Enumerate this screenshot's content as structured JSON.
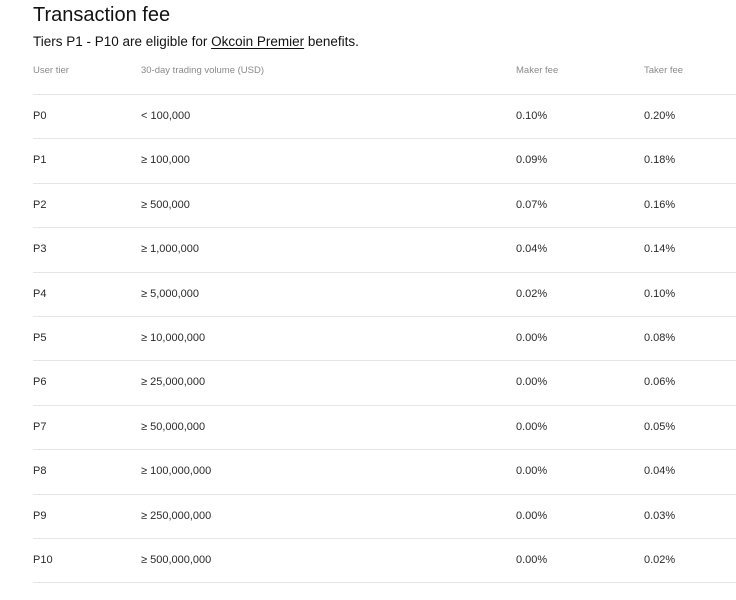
{
  "title": "Transaction fee",
  "subtitle": {
    "prefix": "Tiers P1 - P10 are eligible for ",
    "link": "Okcoin Premier",
    "suffix": " benefits."
  },
  "table": {
    "headers": {
      "tier": "User tier",
      "volume": "30-day trading volume (USD)",
      "maker": "Maker fee",
      "taker": "Taker fee"
    },
    "rows": [
      {
        "tier": "P0",
        "volume": "< 100,000",
        "maker": "0.10%",
        "taker": "0.20%"
      },
      {
        "tier": "P1",
        "volume": "≥ 100,000",
        "maker": "0.09%",
        "taker": "0.18%"
      },
      {
        "tier": "P2",
        "volume": "≥ 500,000",
        "maker": "0.07%",
        "taker": "0.16%"
      },
      {
        "tier": "P3",
        "volume": "≥ 1,000,000",
        "maker": "0.04%",
        "taker": "0.14%"
      },
      {
        "tier": "P4",
        "volume": "≥ 5,000,000",
        "maker": "0.02%",
        "taker": "0.10%"
      },
      {
        "tier": "P5",
        "volume": "≥ 10,000,000",
        "maker": "0.00%",
        "taker": "0.08%"
      },
      {
        "tier": "P6",
        "volume": "≥ 25,000,000",
        "maker": "0.00%",
        "taker": "0.06%"
      },
      {
        "tier": "P7",
        "volume": "≥ 50,000,000",
        "maker": "0.00%",
        "taker": "0.05%"
      },
      {
        "tier": "P8",
        "volume": "≥ 100,000,000",
        "maker": "0.00%",
        "taker": "0.04%"
      },
      {
        "tier": "P9",
        "volume": "≥ 250,000,000",
        "maker": "0.00%",
        "taker": "0.03%"
      },
      {
        "tier": "P10",
        "volume": "≥ 500,000,000",
        "maker": "0.00%",
        "taker": "0.02%"
      }
    ]
  }
}
